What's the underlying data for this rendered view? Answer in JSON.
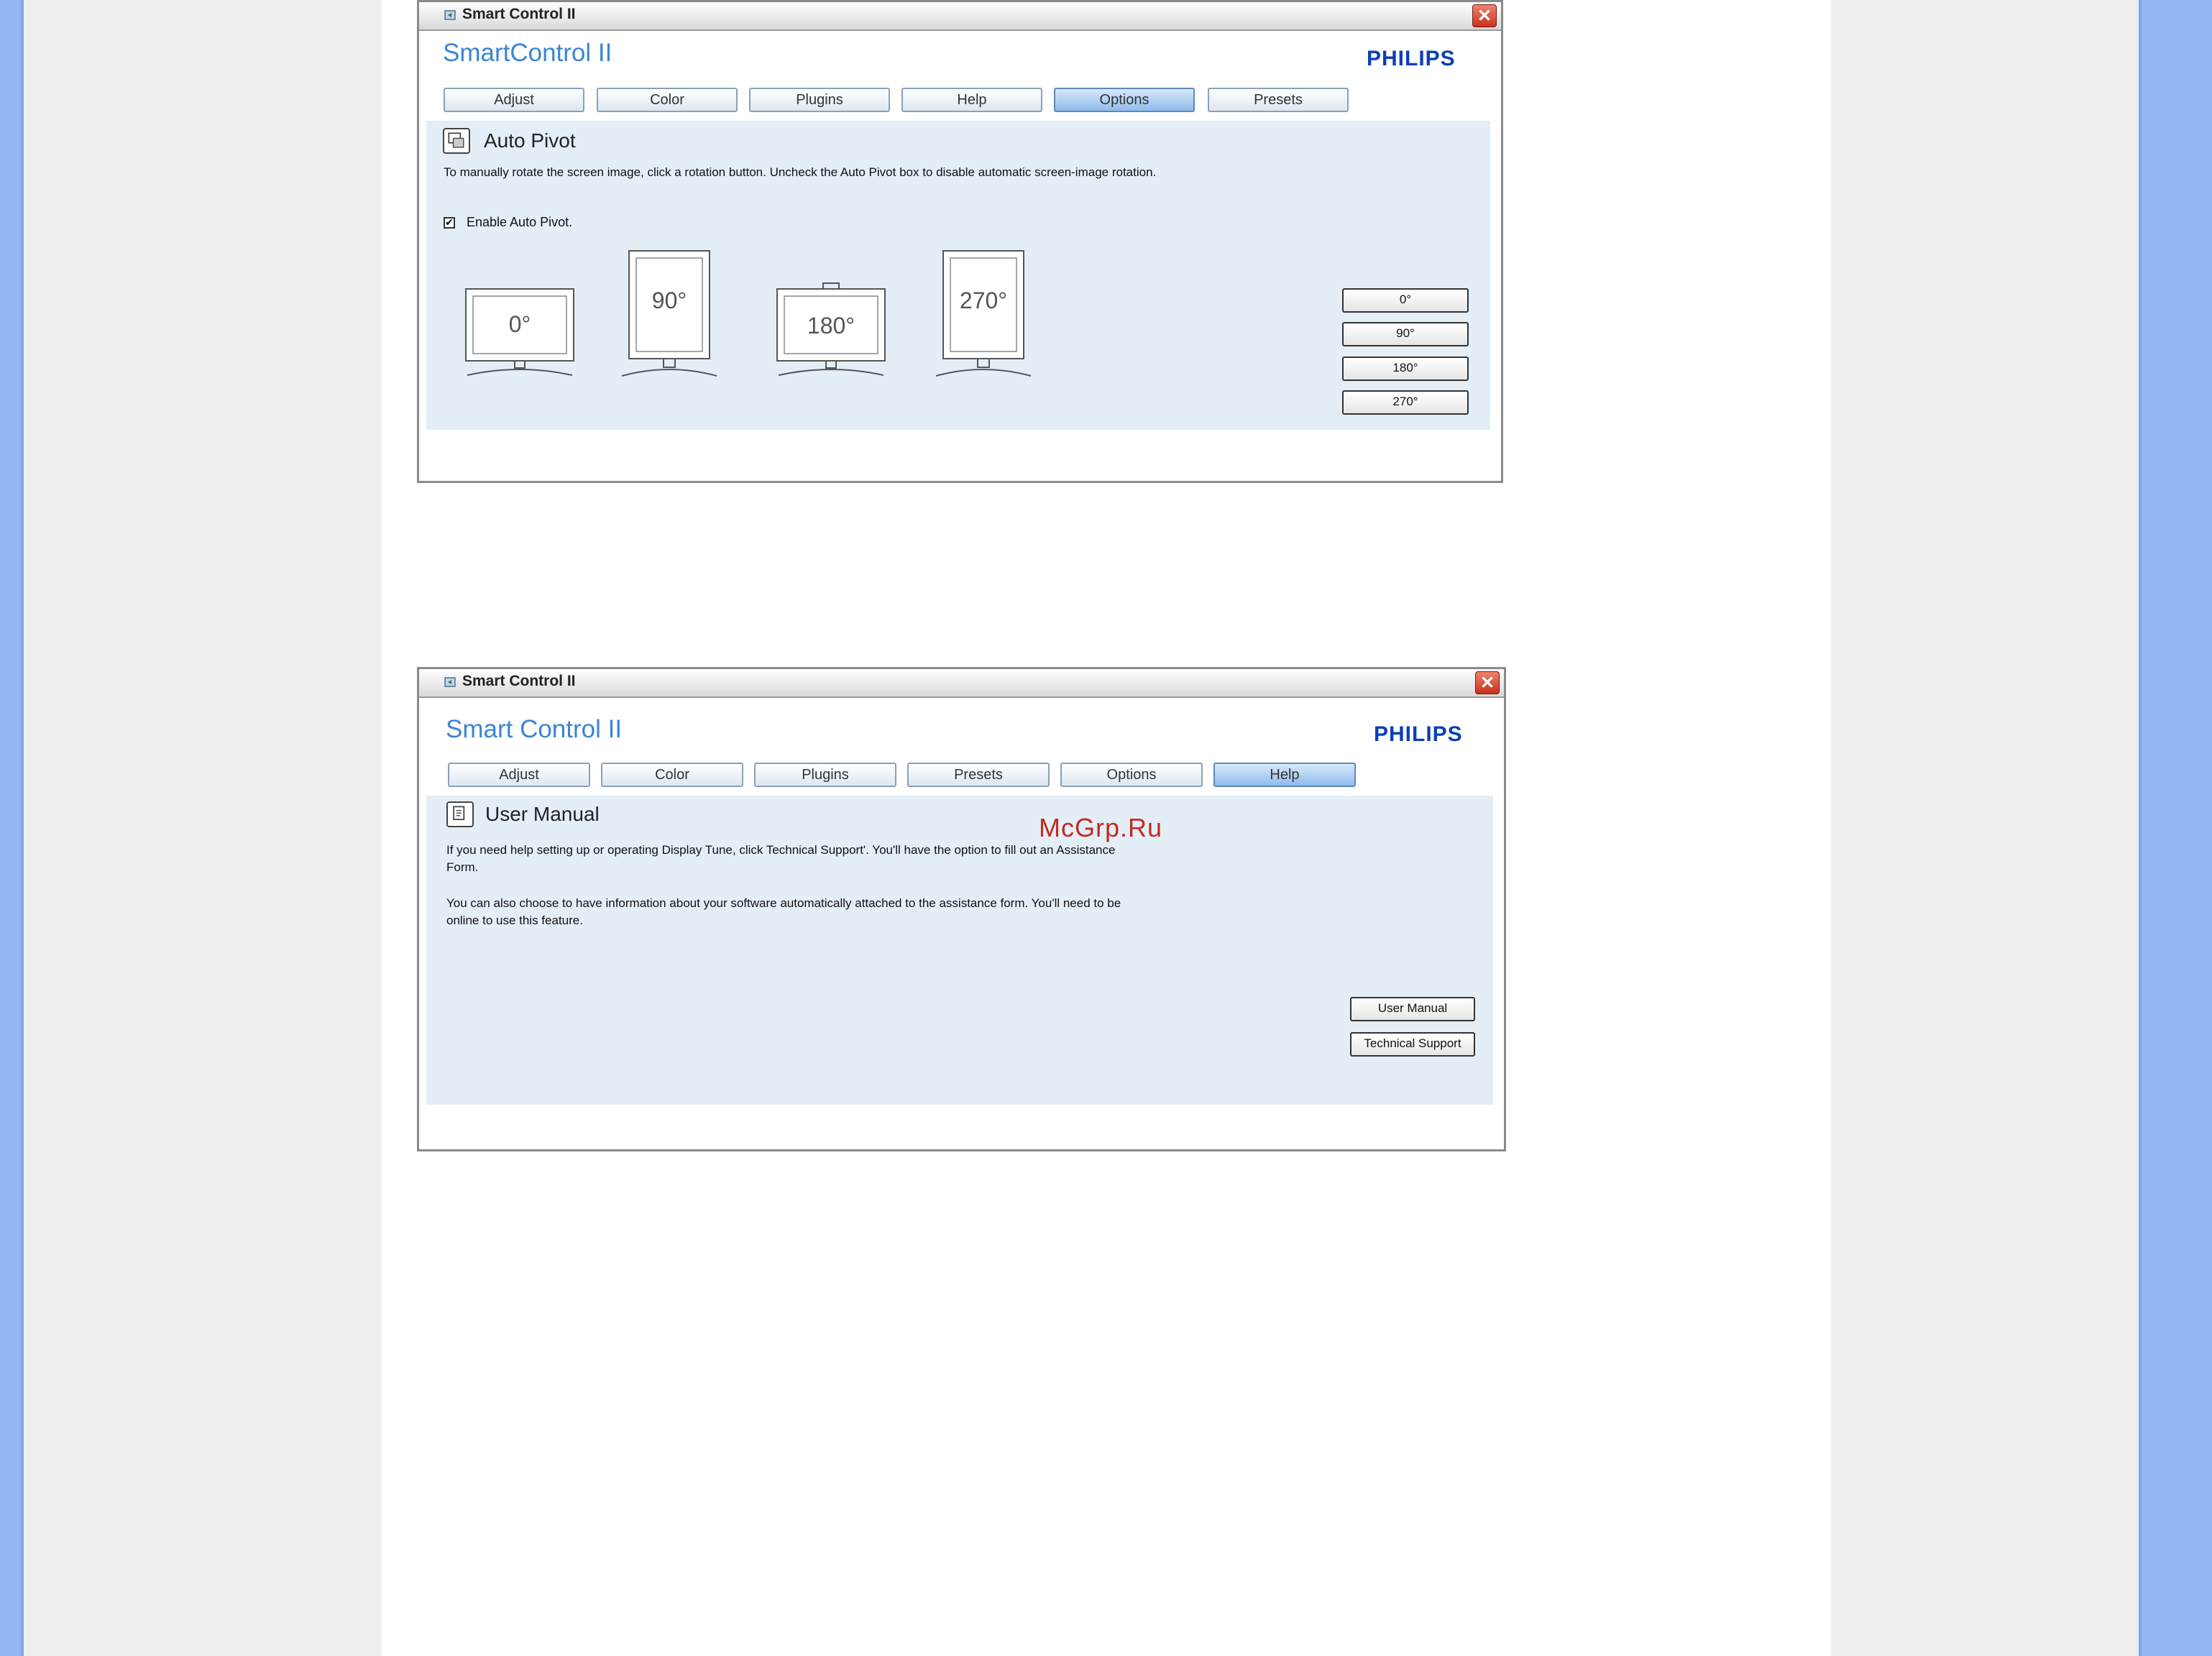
{
  "window1": {
    "title": "Smart Control II",
    "brand": "SmartControl II",
    "logo": "PHILIPS",
    "tabs": [
      {
        "label": "Adjust"
      },
      {
        "label": "Color"
      },
      {
        "label": "Plugins"
      },
      {
        "label": "Help"
      },
      {
        "label": "Options",
        "active": true
      },
      {
        "label": "Presets"
      }
    ],
    "section_title": "Auto Pivot",
    "description": "To manually rotate the screen image, click a rotation button. Uncheck the Auto Pivot box to disable automatic screen-image rotation.",
    "checkbox": {
      "label": "Enable Auto Pivot.",
      "checked": true
    },
    "monitors": [
      "0°",
      "90°",
      "180°",
      "270°"
    ],
    "rotation_buttons": [
      "0°",
      "90°",
      "180°",
      "270°"
    ]
  },
  "window2": {
    "title": "Smart Control II",
    "brand": "Smart Control II",
    "logo": "PHILIPS",
    "tabs": [
      {
        "label": "Adjust"
      },
      {
        "label": "Color"
      },
      {
        "label": "Plugins"
      },
      {
        "label": "Presets"
      },
      {
        "label": "Options"
      },
      {
        "label": "Help",
        "active": true
      }
    ],
    "section_title": "User Manual",
    "description_1": "If you need help setting up or operating Display Tune, click Technical Support'. You'll have the option to fill out an Assistance Form.",
    "description_2": "You can also choose to have information about your software automatically attached to the assistance form. You'll need to be online to use this feature.",
    "buttons": [
      "User Manual",
      "Technical Support"
    ]
  },
  "watermark": "McGrp.Ru",
  "colors": {
    "side_stripe": "#93b8f3",
    "panel": "#e4eef7",
    "brand": "#3b84d6",
    "logo": "#0b3fb5",
    "active_tab": "#8fbbea"
  }
}
